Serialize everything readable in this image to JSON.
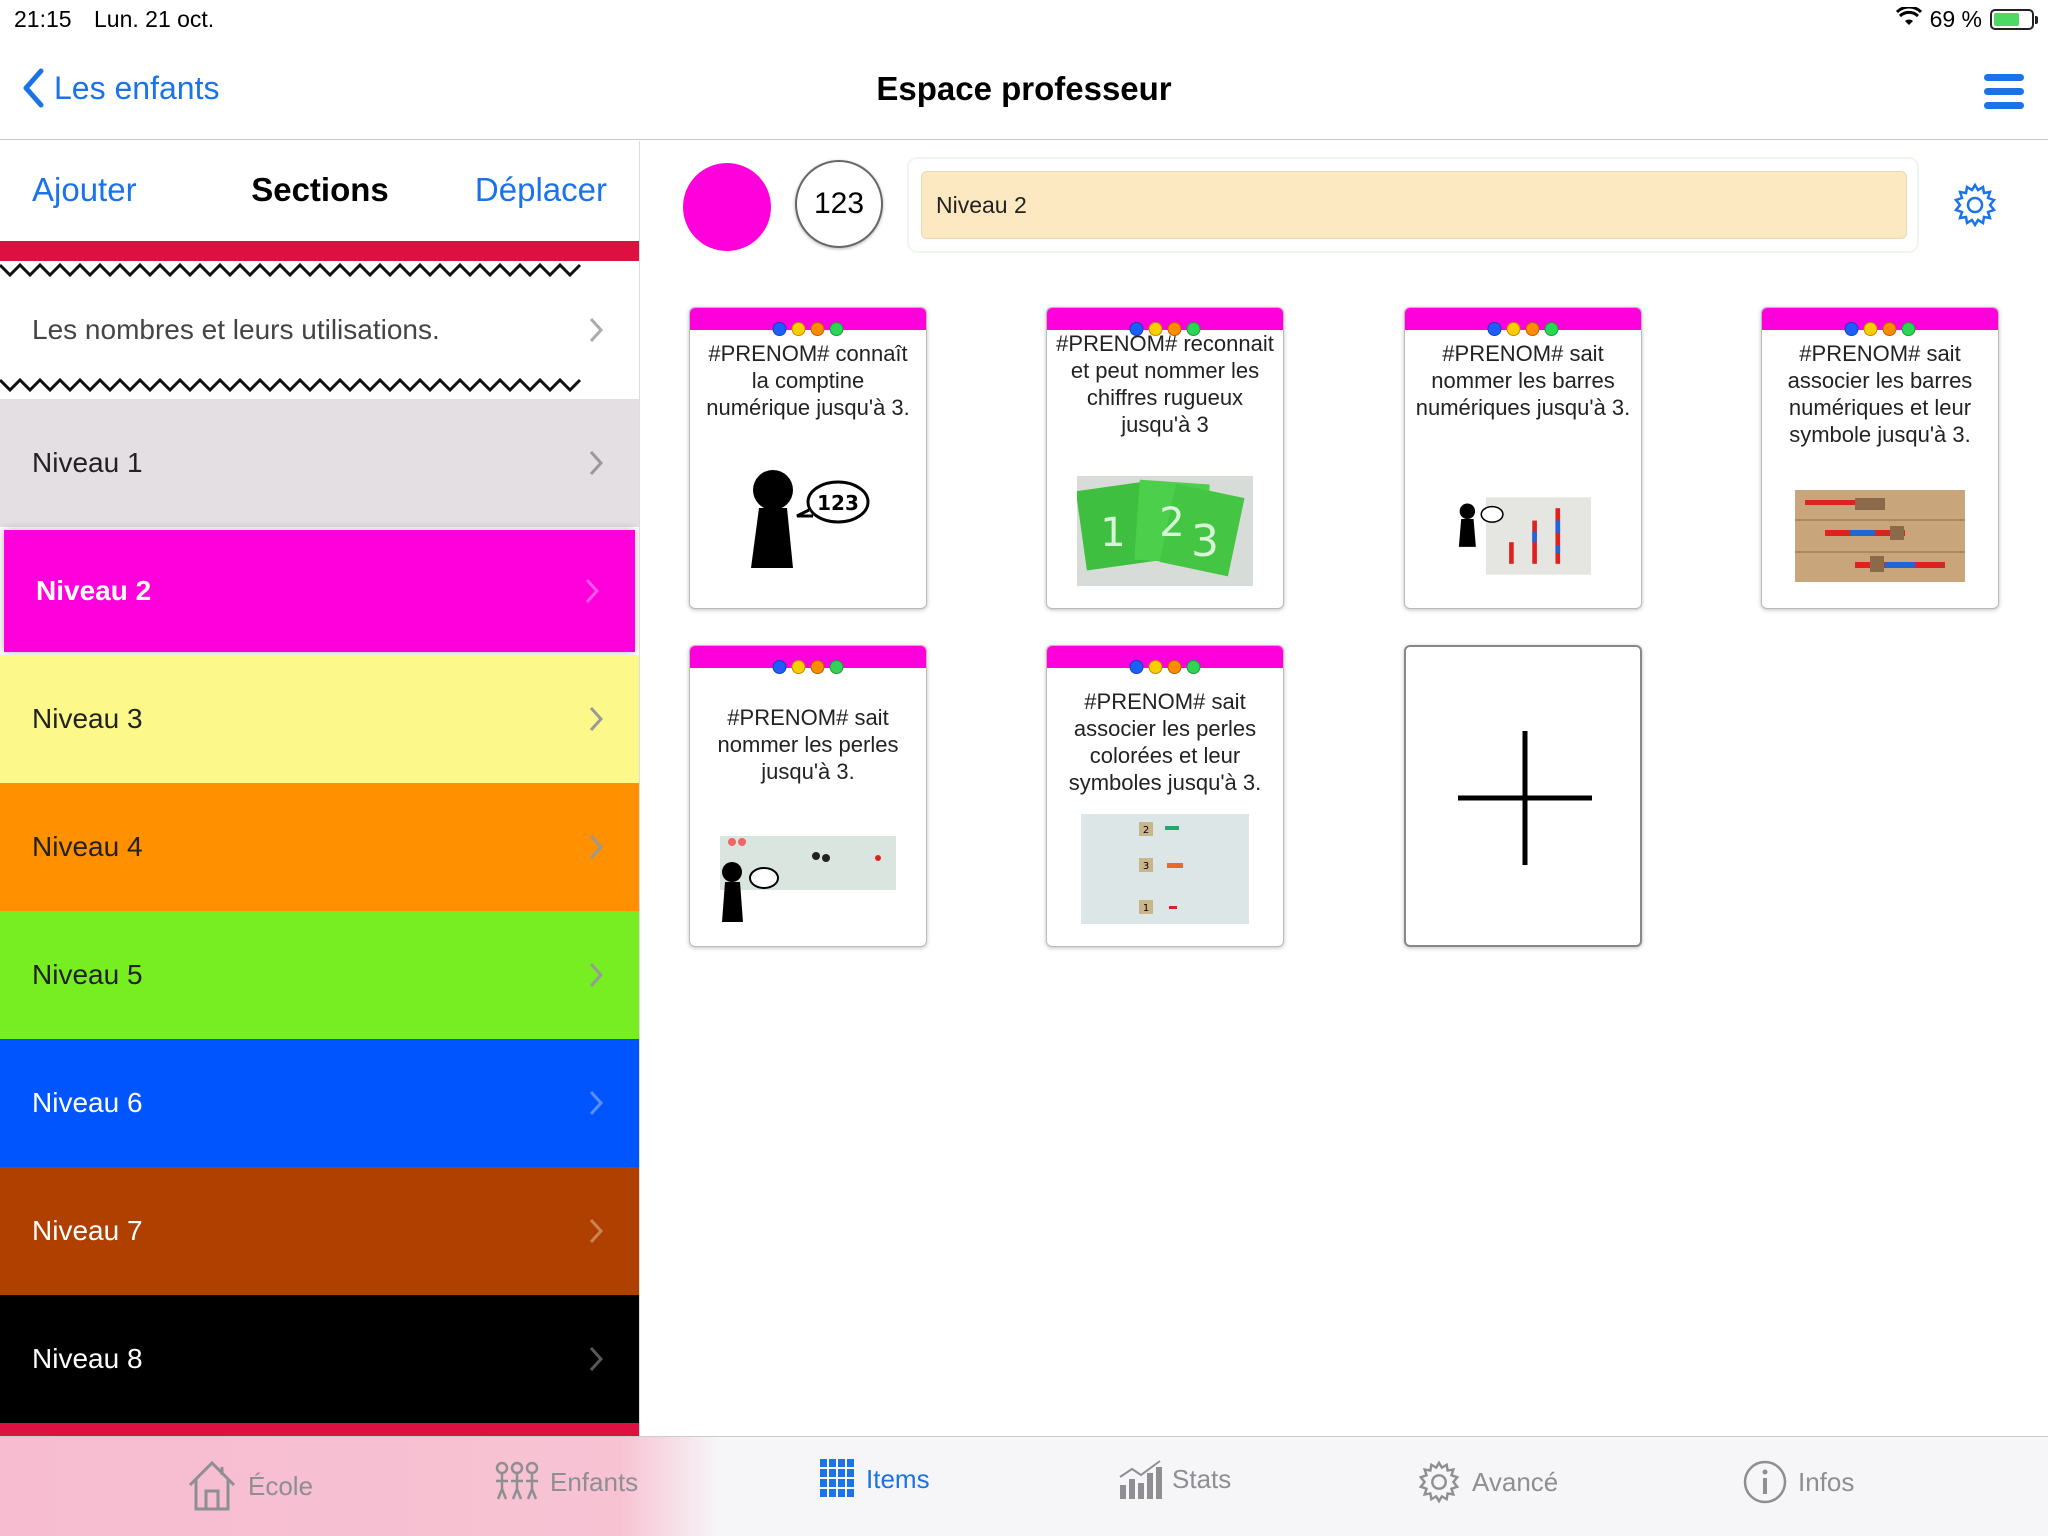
{
  "status": {
    "time": "21:15",
    "date": "Lun. 21 oct.",
    "battery": "69 %",
    "battery_fraction": 0.69
  },
  "nav": {
    "back_label": "Les enfants",
    "title": "Espace professeur"
  },
  "sidebar": {
    "add_label": "Ajouter",
    "title": "Sections",
    "move_label": "Déplacer",
    "section_label": "Les nombres et leurs utilisations.",
    "levels": [
      {
        "label": "Niveau 1",
        "color": "#e3dfe3",
        "text_color": "#222222"
      },
      {
        "label": "Niveau 2",
        "color": "#ff00dd",
        "text_color": "#ffffff",
        "selected": true
      },
      {
        "label": "Niveau 3",
        "color": "#fcf98a",
        "text_color": "#222222"
      },
      {
        "label": "Niveau 4",
        "color": "#ff9000",
        "text_color": "#222222"
      },
      {
        "label": "Niveau 5",
        "color": "#76ee22",
        "text_color": "#222222"
      },
      {
        "label": "Niveau 6",
        "color": "#0055ff",
        "text_color": "#ffffff"
      },
      {
        "label": "Niveau 7",
        "color": "#b04000",
        "text_color": "#ffffff"
      },
      {
        "label": "Niveau 8",
        "color": "#000000",
        "text_color": "#ffffff"
      }
    ]
  },
  "toolbar": {
    "color": "#ff00dd",
    "number_label": "123",
    "level_name": "Niveau 2"
  },
  "cards": [
    {
      "text": "#PRENOM# connaît la comptine numérique jusqu'à 3.",
      "image": "speaking-123-icon"
    },
    {
      "text": "#PRENOM# reconnait et peut nommer les chiffres rugueux jusqu'à 3",
      "image": "sandpaper-numbers-photo"
    },
    {
      "text": "#PRENOM# sait nommer les barres numériques jusqu'à 3.",
      "image": "number-rods-photo"
    },
    {
      "text": "#PRENOM# sait associer les barres numériques et leur symbole jusqu'à 3.",
      "image": "number-rods-symbols-photo"
    },
    {
      "text": "#PRENOM# sait nommer les perles jusqu'à 3.",
      "image": "bead-bars-photo"
    },
    {
      "text": "#PRENOM# sait associer les perles colorées et leur symboles jusqu'à 3.",
      "image": "bead-symbols-photo"
    }
  ],
  "dot_colors": [
    "#1e5eff",
    "#ffcc00",
    "#ff8c00",
    "#2ed456"
  ],
  "tabs": [
    {
      "label": "École",
      "icon": "house-icon"
    },
    {
      "label": "Enfants",
      "icon": "children-icon"
    },
    {
      "label": "Items",
      "icon": "grid-icon",
      "active": true
    },
    {
      "label": "Stats",
      "icon": "chart-icon"
    },
    {
      "label": "Avancé",
      "icon": "gear-icon"
    },
    {
      "label": "Infos",
      "icon": "info-icon"
    }
  ]
}
